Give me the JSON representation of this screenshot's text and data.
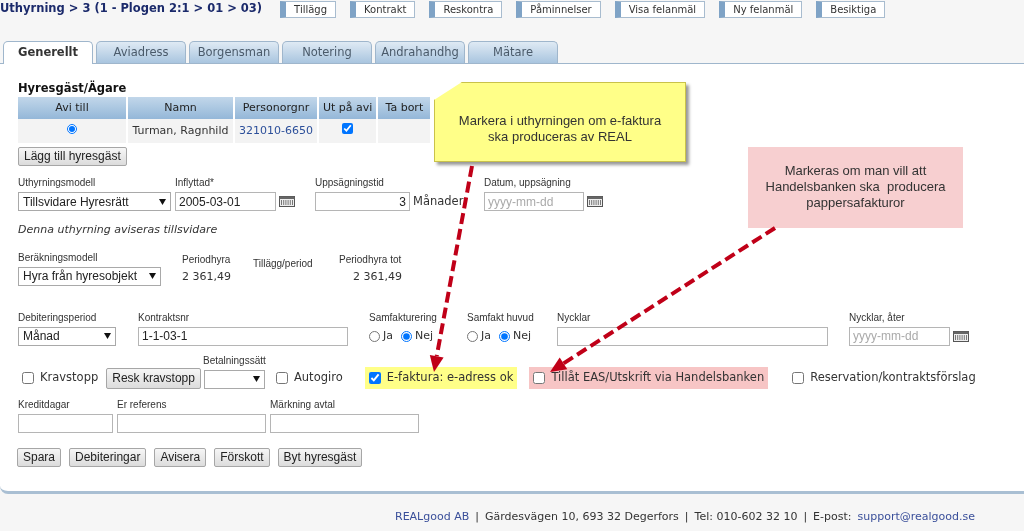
{
  "breadcrumb": "Uthyrning > 3  (1 - Plogen 2:1 > 01 > 03)",
  "toolbar_buttons": [
    "Tillägg",
    "Kontrakt",
    "Reskontra",
    "Påminnelser",
    "Visa felanmäl",
    "Ny felanmäl",
    "Besiktiga"
  ],
  "tabs": [
    {
      "label": "Generellt",
      "selected": true
    },
    {
      "label": "Aviadress",
      "selected": false
    },
    {
      "label": "Borgensman",
      "selected": false
    },
    {
      "label": "Notering",
      "selected": false
    },
    {
      "label": "Andrahandhg",
      "selected": false
    },
    {
      "label": "Mätare",
      "selected": false
    }
  ],
  "tenants": {
    "title": "Hyresgäst/Ägare",
    "columns": [
      "Avi till",
      "Namn",
      "Personorgnr",
      "Ut på avi",
      "Ta bort"
    ],
    "rows": [
      {
        "avi_till_selected": true,
        "name": "Turman, Ragnhild",
        "personorgnr": "321010-6650",
        "ut_pa_avi": true
      }
    ],
    "add_button": "Lägg till hyresgäst"
  },
  "rental": {
    "model": {
      "label": "Uthyrningsmodell",
      "value": "Tillsvidare Hyresrätt"
    },
    "moved_in": {
      "label": "Inflyttad*",
      "value": "2005-03-01"
    },
    "notice": {
      "label": "Uppsägningstid",
      "value": "3",
      "unit": "Månader"
    },
    "notice_date": {
      "label": "Datum, uppsägning",
      "placeholder": "yyyy-mm-dd"
    }
  },
  "billing_note": "Denna uthyrning aviseras tillsvidare",
  "calculation": {
    "model": {
      "label": "Beräkningsmodell",
      "value": "Hyra från hyresobjekt"
    },
    "rent": {
      "label": "Periodhyra",
      "value": "2 361,49"
    },
    "extra": {
      "label": "Tillägg/period"
    },
    "total": {
      "label": "Periodhyra tot",
      "value": "2 361,49"
    }
  },
  "debit": {
    "period": {
      "label": "Debiteringsperiod",
      "value": "Månad"
    },
    "contract_no": {
      "label": "Kontraktsnr",
      "value": "1-1-03-1"
    },
    "co_invoicing": {
      "label": "Samfakturering",
      "options": [
        {
          "label": "Ja",
          "selected": false
        },
        {
          "label": "Nej",
          "selected": true
        }
      ]
    },
    "co_invoicing_main": {
      "label": "Samfakt huvud",
      "options": [
        {
          "label": "Ja",
          "selected": false
        },
        {
          "label": "Nej",
          "selected": true
        }
      ]
    },
    "keys": {
      "label": "Nycklar"
    },
    "keys_return": {
      "label": "Nycklar, åter",
      "placeholder": "yyyy-mm-dd"
    }
  },
  "options": [
    {
      "kind": "checkbox",
      "label": "Kravstopp",
      "checked": false
    },
    {
      "kind": "button",
      "label": "Resk kravstopp"
    },
    {
      "kind": "select",
      "label": "Betalningssätt"
    },
    {
      "kind": "checkbox",
      "label": "Autogiro",
      "checked": false
    },
    {
      "kind": "checkbox",
      "label": "E-faktura: e-adress ok",
      "checked": true,
      "color": "#ffff88"
    },
    {
      "kind": "checkbox",
      "label": "Tillåt EAS/Utskrift via Handelsbanken",
      "checked": false,
      "color": "#f7c5c5"
    },
    {
      "kind": "checkbox",
      "label": "Reservation/kontraktsförslag",
      "checked": false
    }
  ],
  "extra_fields": [
    {
      "label": "Kreditdagar"
    },
    {
      "label": "Er referens"
    },
    {
      "label": "Märkning avtal"
    }
  ],
  "action_buttons": [
    "Spara",
    "Debiteringar",
    "Avisera",
    "Förskott",
    "Byt hyresgäst"
  ],
  "callouts": [
    {
      "kind": "note",
      "text": "Markera i uthyrningen om e-faktura ska produceras av REAL"
    },
    {
      "kind": "box",
      "text": "Markeras om man vill att Handelsbanken ska  producera pappersafakturor"
    }
  ],
  "footer": [
    {
      "kind": "link",
      "text": "REALgood AB"
    },
    {
      "kind": "text",
      "text": "|"
    },
    {
      "kind": "text",
      "text": "Gärdesvägen 10, 693 32 Degerfors"
    },
    {
      "kind": "text",
      "text": "|"
    },
    {
      "kind": "text",
      "text": "Tel: 010-602 32 10"
    },
    {
      "kind": "text",
      "text": "|"
    },
    {
      "kind": "text",
      "text": "E-post:"
    },
    {
      "kind": "link",
      "text": "support@realgood.se"
    }
  ]
}
